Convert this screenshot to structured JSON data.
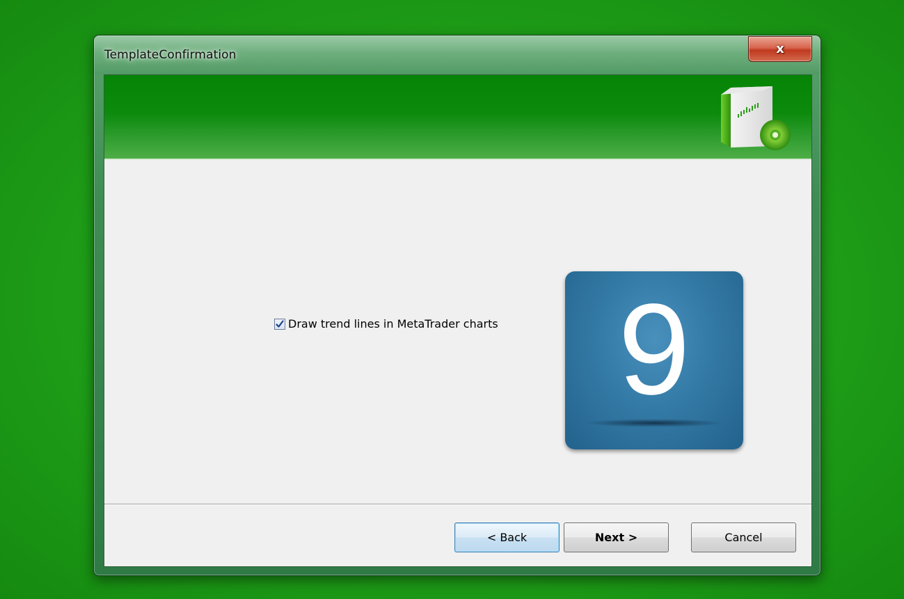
{
  "window": {
    "title": "TemplateConfirmation",
    "close_label": "x"
  },
  "banner": {
    "icon": "metatrader-product-box-icon"
  },
  "content": {
    "checkbox_label": "Draw trend lines in MetaTrader charts",
    "checkbox_checked": true,
    "step_number": "9"
  },
  "buttons": {
    "back": "< Back",
    "next": "Next >",
    "cancel": "Cancel"
  }
}
